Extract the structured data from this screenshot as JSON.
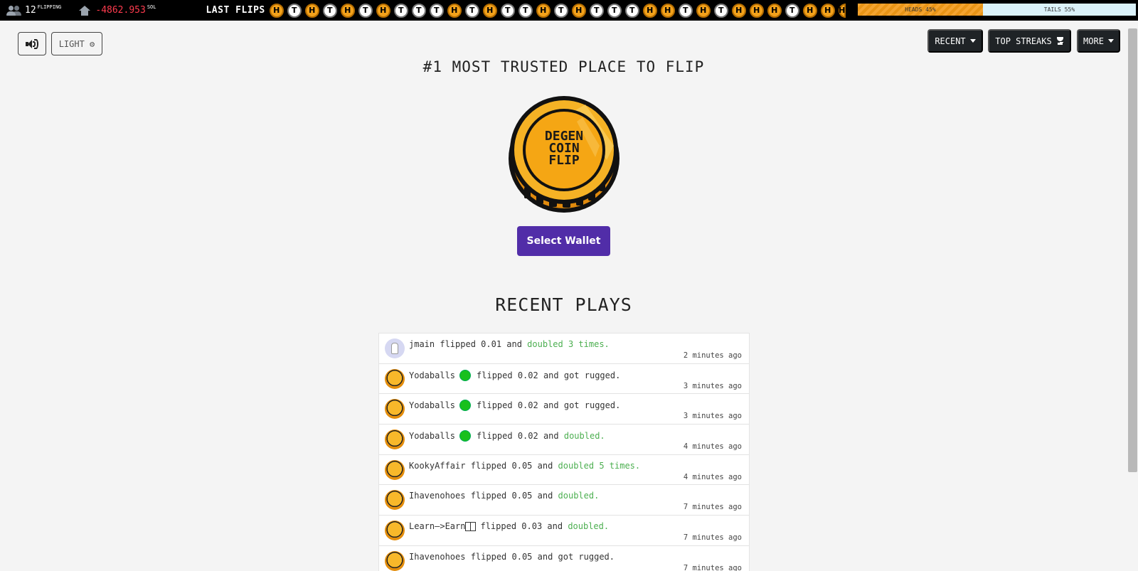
{
  "topbar": {
    "online_count": "12",
    "online_label": "FLIPPING",
    "house_value": "-4862.953",
    "house_unit": "SOL",
    "last_flips_label": "LAST FLIPS",
    "flips": [
      "H",
      "T",
      "H",
      "T",
      "H",
      "T",
      "H",
      "T",
      "T",
      "T",
      "H",
      "T",
      "H",
      "T",
      "T",
      "H",
      "T",
      "H",
      "T",
      "T",
      "T",
      "H",
      "H",
      "T",
      "H",
      "T",
      "H",
      "H",
      "H",
      "T",
      "H",
      "H",
      "H"
    ],
    "heads_label": "HEADS 45%",
    "tails_label": "TAILS 55%",
    "heads_ratio": 0.45,
    "tails_ratio": 0.55
  },
  "controls": {
    "light_label": "LIGHT ⚙",
    "recent_label": "RECENT",
    "top_streaks_label": "TOP STREAKS",
    "more_label": "MORE"
  },
  "main": {
    "headline": "#1 MOST TRUSTED PLACE TO FLIP",
    "coin_text": [
      "DEGEN",
      "COIN",
      "FLIP"
    ],
    "select_wallet_label": "Select Wallet",
    "recent_plays_title": "RECENT PLAYS"
  },
  "plays": [
    {
      "user": "jmain",
      "emoji": false,
      "mid": " flipped 0.01 and ",
      "result": "doubled 3 times.",
      "result_green": true,
      "time": "2 minutes ago",
      "avatar": "user"
    },
    {
      "user": "Yodaballs",
      "emoji": true,
      "mid": "flipped 0.02 and got rugged.",
      "result": "",
      "result_green": false,
      "time": "3 minutes ago",
      "avatar": "coin"
    },
    {
      "user": "Yodaballs",
      "emoji": true,
      "mid": "flipped 0.02 and got rugged.",
      "result": "",
      "result_green": false,
      "time": "3 minutes ago",
      "avatar": "coin"
    },
    {
      "user": "Yodaballs",
      "emoji": true,
      "mid": "flipped 0.02 and ",
      "result": "doubled.",
      "result_green": true,
      "time": "4 minutes ago",
      "avatar": "coin"
    },
    {
      "user": "KookyAffair",
      "emoji": false,
      "mid": " flipped 0.05 and ",
      "result": "doubled 5 times.",
      "result_green": true,
      "time": "4 minutes ago",
      "avatar": "coin"
    },
    {
      "user": "Ihavenohoes",
      "emoji": false,
      "mid": " flipped 0.05 and ",
      "result": "doubled.",
      "result_green": true,
      "time": "7 minutes ago",
      "avatar": "coin"
    },
    {
      "user": "Learn—>Earn",
      "emoji": false,
      "boxes": true,
      "mid": "flipped 0.03 and ",
      "result": "doubled.",
      "result_green": true,
      "time": "7 minutes ago",
      "avatar": "coin"
    },
    {
      "user": "Ihavenohoes",
      "emoji": false,
      "mid": " flipped 0.05 and got rugged.",
      "result": "",
      "result_green": false,
      "time": "7 minutes ago",
      "avatar": "coin"
    }
  ],
  "colors": {
    "accent_orange": "#f3a21b",
    "wallet_purple": "#512da8",
    "win_green": "#4caf50",
    "loss_red": "#ff3b4e"
  }
}
